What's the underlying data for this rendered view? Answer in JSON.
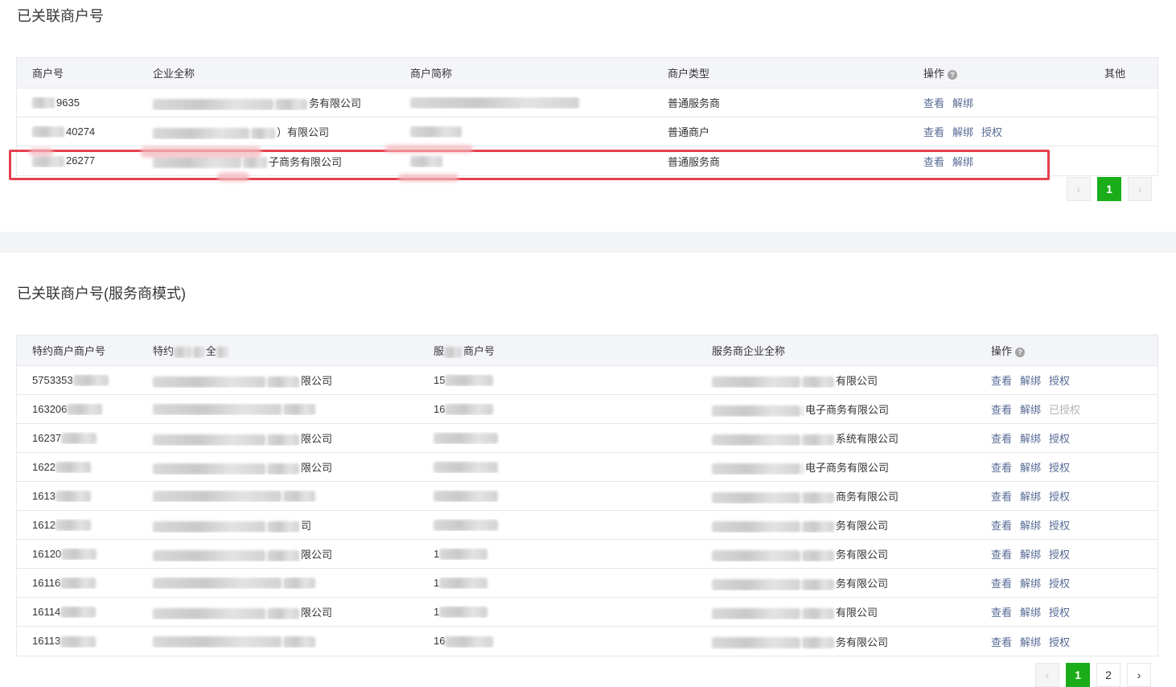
{
  "section1": {
    "title": "已关联商户号",
    "headers": {
      "merchant_id": "商户号",
      "company_name": "企业全称",
      "short_name": "商户简称",
      "merchant_type": "商户类型",
      "operation": "操作",
      "other": "其他"
    },
    "rows": [
      {
        "merchant_id": "9635",
        "company_name": "务有限公司",
        "short_name": "",
        "merchant_type": "普通服务商",
        "actions": [
          "查看",
          "解绑"
        ]
      },
      {
        "merchant_id": "40274",
        "company_name": "）有限公司",
        "short_name": "",
        "merchant_type": "普通商户",
        "actions": [
          "查看",
          "解绑",
          "授权"
        ]
      },
      {
        "merchant_id": "26277",
        "company_name": "子商务有限公司",
        "short_name": "",
        "merchant_type": "普通服务商",
        "actions": [
          "查看",
          "解绑"
        ]
      }
    ],
    "pagination": {
      "prev": "‹",
      "current": "1",
      "next": "›"
    }
  },
  "section2": {
    "title": "已关联商户号(服务商模式)",
    "headers": {
      "sub_merchant_id": "特约商户商户号",
      "sub_company_name": "特约",
      "sub_company_name_tail": "全",
      "sp_merchant_id": "服",
      "sp_merchant_id_tail": "商户号",
      "sp_company_name": "服务商企业全称",
      "operation": "操作"
    },
    "rows": [
      {
        "sub_id": "5753353",
        "sub_name": "限公司",
        "sp_id": "15",
        "sp_name": "有限公司",
        "actions": [
          "查看",
          "解绑",
          "授权"
        ],
        "disabled": [
          false,
          false,
          false
        ]
      },
      {
        "sub_id": "163206",
        "sub_name": "",
        "sp_id": "16",
        "sp_name": "电子商务有限公司",
        "actions": [
          "查看",
          "解绑",
          "已授权"
        ],
        "disabled": [
          false,
          false,
          true
        ]
      },
      {
        "sub_id": "16237",
        "sub_name": "限公司",
        "sp_id": "",
        "sp_name": "系统有限公司",
        "actions": [
          "查看",
          "解绑",
          "授权"
        ],
        "disabled": [
          false,
          false,
          false
        ]
      },
      {
        "sub_id": "1622",
        "sub_name": "限公司",
        "sp_id": "",
        "sp_name": "电子商务有限公司",
        "actions": [
          "查看",
          "解绑",
          "授权"
        ],
        "disabled": [
          false,
          false,
          false
        ]
      },
      {
        "sub_id": "1613",
        "sub_name": "",
        "sp_id": "",
        "sp_name": "商务有限公司",
        "actions": [
          "查看",
          "解绑",
          "授权"
        ],
        "disabled": [
          false,
          false,
          false
        ]
      },
      {
        "sub_id": "1612",
        "sub_name": "司",
        "sp_id": "",
        "sp_name": "务有限公司",
        "actions": [
          "查看",
          "解绑",
          "授权"
        ],
        "disabled": [
          false,
          false,
          false
        ]
      },
      {
        "sub_id": "16120",
        "sub_name": "限公司",
        "sp_id": "1",
        "sp_name": "务有限公司",
        "actions": [
          "查看",
          "解绑",
          "授权"
        ],
        "disabled": [
          false,
          false,
          false
        ]
      },
      {
        "sub_id": "16116",
        "sub_name": "",
        "sp_id": "1",
        "sp_name": "务有限公司",
        "actions": [
          "查看",
          "解绑",
          "授权"
        ],
        "disabled": [
          false,
          false,
          false
        ]
      },
      {
        "sub_id": "16114",
        "sub_name": "限公司",
        "sp_id": "1",
        "sp_name": "有限公司",
        "actions": [
          "查看",
          "解绑",
          "授权"
        ],
        "disabled": [
          false,
          false,
          false
        ]
      },
      {
        "sub_id": "16113",
        "sub_name": "",
        "sp_id": "16",
        "sp_name": "务有限公司",
        "actions": [
          "查看",
          "解绑",
          "授权"
        ],
        "disabled": [
          false,
          false,
          false
        ]
      }
    ],
    "pagination": {
      "prev": "‹",
      "pages": [
        "1",
        "2"
      ],
      "current": "1",
      "next": "›"
    }
  },
  "help_icon_glyph": "?",
  "colors": {
    "link": "#576b95",
    "active_page": "#1aad19",
    "highlight": "#e5404d"
  }
}
